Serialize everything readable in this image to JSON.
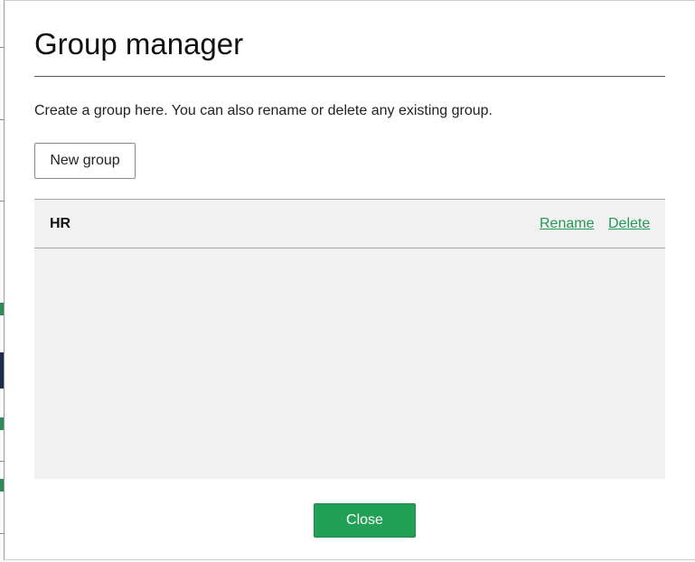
{
  "modal": {
    "title": "Group manager",
    "intro": "Create a group here. You can also rename or delete any existing group.",
    "new_group_label": "New group",
    "close_label": "Close"
  },
  "groups": [
    {
      "name": "HR",
      "rename_label": "Rename",
      "delete_label": "Delete"
    }
  ],
  "colors": {
    "accent_green": "#22a055",
    "link_green": "#229954",
    "panel_gray": "#f1f1f1"
  }
}
